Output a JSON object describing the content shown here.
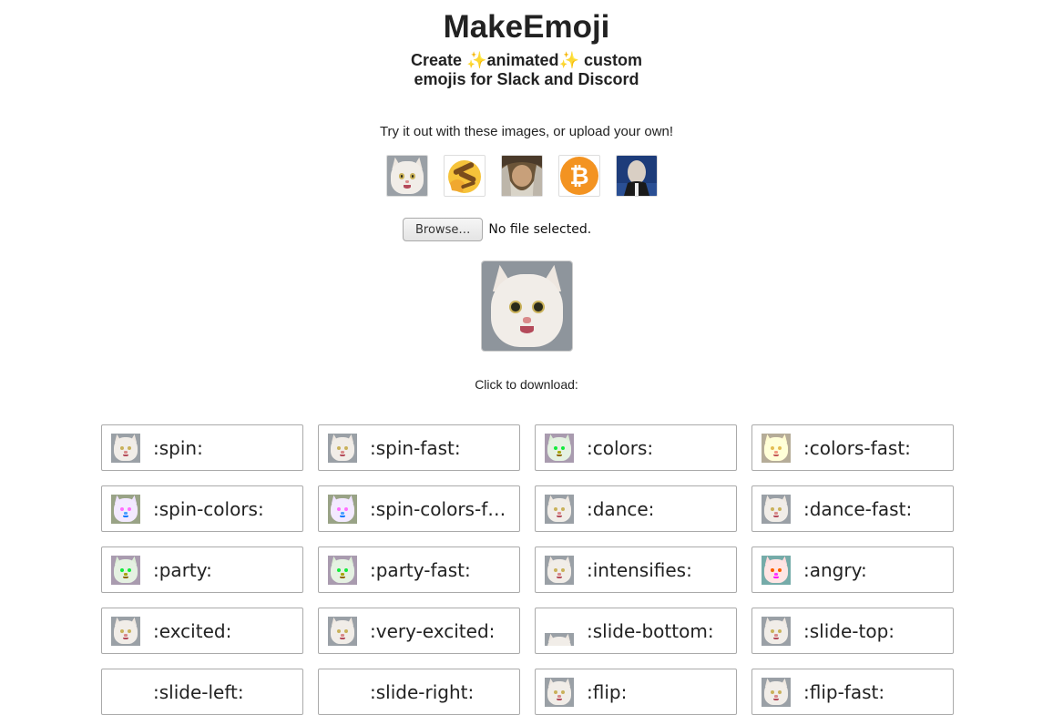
{
  "header": {
    "title": "MakeEmoji",
    "subtitle_line1_a": "Create ",
    "subtitle_sparkle1": "✨",
    "subtitle_line1_b": "animated",
    "subtitle_sparkle2": "✨",
    "subtitle_line1_c": " custom",
    "subtitle_line2": "emojis for Slack and Discord"
  },
  "prompt": "Try it out with these images, or upload your own!",
  "samples": [
    {
      "name": "cat"
    },
    {
      "name": "thinking-emoji"
    },
    {
      "name": "wizard"
    },
    {
      "name": "bitcoin",
      "symbol": "₿"
    },
    {
      "name": "stonks-man"
    }
  ],
  "file_input": {
    "button_label": "Browse…",
    "status": "No file selected."
  },
  "click_label": "Click to download:",
  "emojis": [
    {
      "name": ":spin:",
      "tint": "none"
    },
    {
      "name": ":spin-fast:",
      "tint": "none"
    },
    {
      "name": ":colors:",
      "tint": "green"
    },
    {
      "name": ":colors-fast:",
      "tint": "warm"
    },
    {
      "name": ":spin-colors:",
      "tint": "purple"
    },
    {
      "name": ":spin-colors-fast:",
      "tint": "purple"
    },
    {
      "name": ":dance:",
      "tint": "none"
    },
    {
      "name": ":dance-fast:",
      "tint": "none"
    },
    {
      "name": ":party:",
      "tint": "green"
    },
    {
      "name": ":party-fast:",
      "tint": "green"
    },
    {
      "name": ":intensifies:",
      "tint": "none"
    },
    {
      "name": ":angry:",
      "tint": "red"
    },
    {
      "name": ":excited:",
      "tint": "none"
    },
    {
      "name": ":very-excited:",
      "tint": "none"
    },
    {
      "name": ":slide-bottom:",
      "tint": "none"
    },
    {
      "name": ":slide-top:",
      "tint": "none"
    },
    {
      "name": ":slide-left:",
      "tint": "none"
    },
    {
      "name": ":slide-right:",
      "tint": "none"
    },
    {
      "name": ":flip:",
      "tint": "none"
    },
    {
      "name": ":flip-fast:",
      "tint": "none"
    }
  ]
}
